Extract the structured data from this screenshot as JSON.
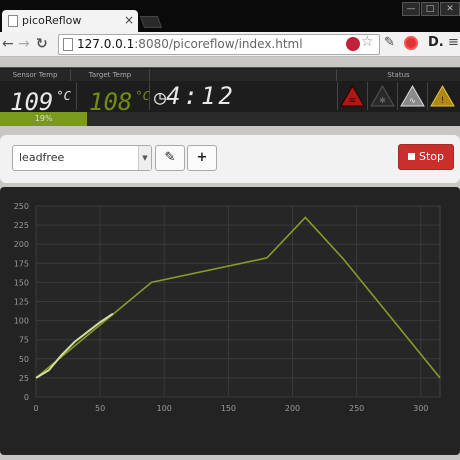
{
  "browser": {
    "tab_title": "picoReflow",
    "tab_close": "×",
    "url_host": "127.0.0.1",
    "url_rest": ":8080/picoreflow/index.html",
    "win_min": "—",
    "win_max": "□",
    "win_close": "✕"
  },
  "status": {
    "sensor_label": "Sensor Temp",
    "sensor_value": "109",
    "sensor_unit": "°C",
    "target_label": "Target Temp",
    "target_value": "108",
    "target_unit": "°C",
    "time_value": "4:12",
    "status_label": "Status",
    "progress_label": "19%",
    "progress": 0.19,
    "indicator_colors": [
      "#b01818",
      "#2a2a2a",
      "#8a8a8a",
      "#b08a10"
    ]
  },
  "controls": {
    "profile_value": "leadfree",
    "stop_label": "Stop",
    "edit_icon": "✎",
    "add_icon": "+"
  },
  "chart_data": {
    "type": "line",
    "xlim": [
      0,
      315
    ],
    "ylim": [
      0,
      250
    ],
    "xticks": [
      0,
      50,
      100,
      150,
      200,
      250,
      300
    ],
    "yticks": [
      0,
      25,
      50,
      75,
      100,
      125,
      150,
      175,
      200,
      225,
      250
    ],
    "grid": true,
    "series": [
      {
        "color": "#8a9a2a",
        "x": [
          0,
          90,
          180,
          210,
          240,
          315
        ],
        "y": [
          25,
          150,
          182,
          235,
          180,
          25
        ]
      },
      {
        "color": "#cfe09a",
        "x": [
          0,
          10,
          20,
          30,
          40,
          50,
          60
        ],
        "y": [
          25,
          35,
          55,
          72,
          85,
          98,
          109
        ]
      }
    ]
  }
}
